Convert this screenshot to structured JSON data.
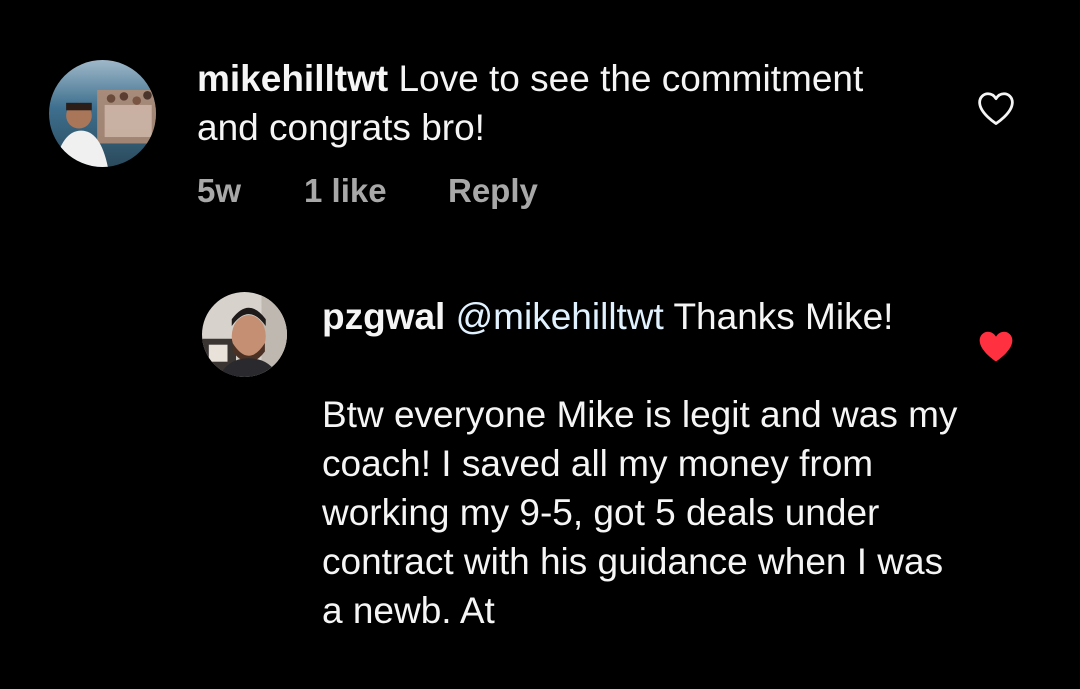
{
  "comment": {
    "username": "mikehilltwt",
    "text": "Love to see the commitment and congrats bro!",
    "time": "5w",
    "likes": "1 like",
    "reply_label": "Reply",
    "liked": false,
    "heart_icon": "heart-outline-icon"
  },
  "reply": {
    "username": "pzgwal",
    "mention": "@mikehilltwt",
    "text_line1": " Thanks Mike!",
    "text_body": "Btw everyone Mike is legit and was my coach! I saved all my money from working my 9-5, got 5 deals under contract with his guidance when I was a newb. At",
    "liked": true,
    "heart_icon": "heart-filled-icon"
  },
  "colors": {
    "background": "#000000",
    "text": "#f5f5f5",
    "meta": "#a8a8a8",
    "heart_filled": "#ff3040",
    "heart_outline": "#f5f5f5"
  }
}
